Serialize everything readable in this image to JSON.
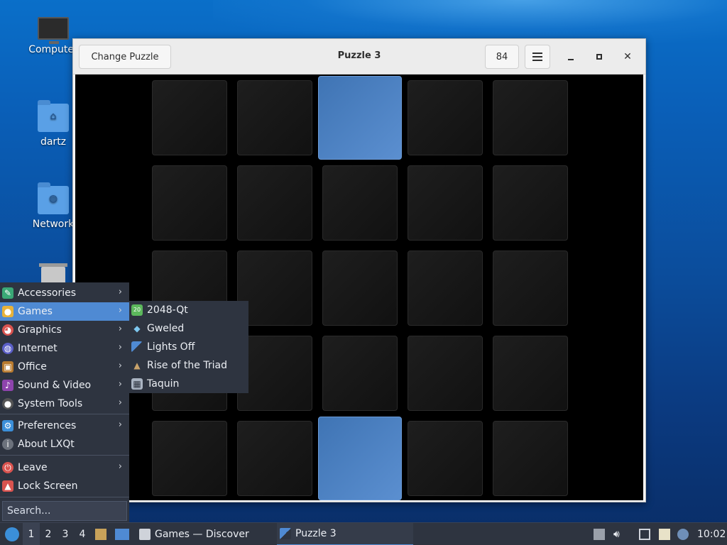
{
  "desktop": {
    "icons": [
      {
        "label": "Computer",
        "icon": "computer-icon"
      },
      {
        "label": "dartz",
        "icon": "home-folder-icon"
      },
      {
        "label": "Network",
        "icon": "network-folder-icon"
      },
      {
        "label": "",
        "icon": "trash-icon"
      }
    ]
  },
  "window": {
    "title": "Puzzle 3",
    "change_button": "Change Puzzle",
    "moves": "84",
    "controls": [
      "minimize",
      "maximize",
      "close"
    ],
    "board": {
      "rows": 5,
      "cols": 5,
      "lit_tiles": [
        [
          0,
          2
        ],
        [
          4,
          2
        ]
      ],
      "colors": {
        "off": "#151515",
        "on": "#4f86c6",
        "background": "#000000"
      }
    }
  },
  "start_menu": {
    "items": [
      {
        "label": "Accessories",
        "icon": "accessories-icon",
        "submenu": true
      },
      {
        "label": "Games",
        "icon": "games-icon",
        "submenu": true,
        "active": true
      },
      {
        "label": "Graphics",
        "icon": "graphics-icon",
        "submenu": true
      },
      {
        "label": "Internet",
        "icon": "internet-icon",
        "submenu": true
      },
      {
        "label": "Office",
        "icon": "office-icon",
        "submenu": true
      },
      {
        "label": "Sound & Video",
        "icon": "sound-video-icon",
        "submenu": true
      },
      {
        "label": "System Tools",
        "icon": "system-tools-icon",
        "submenu": true
      },
      {
        "label": "Preferences",
        "icon": "preferences-icon",
        "submenu": true
      },
      {
        "label": "About LXQt",
        "icon": "about-icon",
        "submenu": false
      },
      {
        "label": "Leave",
        "icon": "leave-icon",
        "submenu": true
      },
      {
        "label": "Lock Screen",
        "icon": "lock-icon",
        "submenu": false
      }
    ],
    "search_placeholder": "Search...",
    "games_submenu": [
      {
        "label": "2048-Qt",
        "icon": "2048-icon"
      },
      {
        "label": "Gweled",
        "icon": "gweled-icon"
      },
      {
        "label": "Lights Off",
        "icon": "lights-off-icon"
      },
      {
        "label": "Rise of the Triad",
        "icon": "rott-icon"
      },
      {
        "label": "Taquin",
        "icon": "taquin-icon"
      }
    ]
  },
  "taskbar": {
    "desktops": [
      "1",
      "2",
      "3",
      "4"
    ],
    "active_desktop": "1",
    "tasks": [
      {
        "label": "Games — Discover",
        "icon": "discover-icon"
      },
      {
        "label": "Puzzle 3",
        "icon": "puzzle-icon",
        "active": true
      }
    ],
    "clock": "10:02"
  }
}
